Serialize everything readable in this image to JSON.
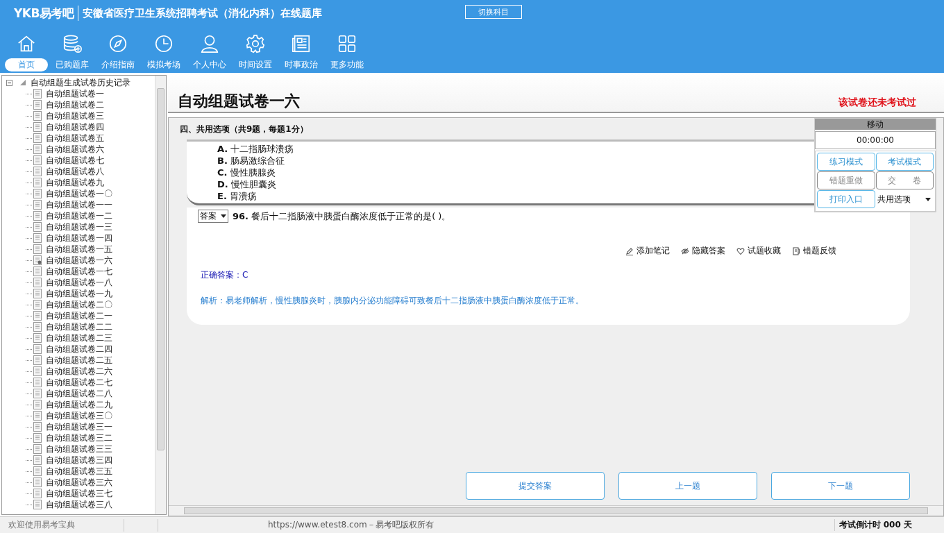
{
  "header": {
    "logo": "YKB易考吧",
    "title": "安徽省医疗卫生系统招聘考试（消化内科）在线题库",
    "switch_button": "切换科目"
  },
  "nav": [
    {
      "label": "首页",
      "selected": true
    },
    {
      "label": "已购题库",
      "selected": false
    },
    {
      "label": "介绍指南",
      "selected": false
    },
    {
      "label": "模拟考场",
      "selected": false
    },
    {
      "label": "个人中心",
      "selected": false
    },
    {
      "label": "时间设置",
      "selected": false
    },
    {
      "label": "时事政治",
      "selected": false
    },
    {
      "label": "更多功能",
      "selected": false
    }
  ],
  "tree": {
    "root": "自动组题生成试卷历史记录",
    "expanded": true,
    "children": [
      {
        "label": "自动组题试卷一",
        "current": false
      },
      {
        "label": "自动组题试卷二",
        "current": false
      },
      {
        "label": "自动组题试卷三",
        "current": false
      },
      {
        "label": "自动组题试卷四",
        "current": false
      },
      {
        "label": "自动组题试卷五",
        "current": false
      },
      {
        "label": "自动组题试卷六",
        "current": false
      },
      {
        "label": "自动组题试卷七",
        "current": false
      },
      {
        "label": "自动组题试卷八",
        "current": false
      },
      {
        "label": "自动组题试卷九",
        "current": false
      },
      {
        "label": "自动组题试卷一〇",
        "current": false
      },
      {
        "label": "自动组题试卷一一",
        "current": false
      },
      {
        "label": "自动组题试卷一二",
        "current": false
      },
      {
        "label": "自动组题试卷一三",
        "current": false
      },
      {
        "label": "自动组题试卷一四",
        "current": false
      },
      {
        "label": "自动组题试卷一五",
        "current": false
      },
      {
        "label": "自动组题试卷一六",
        "current": true
      },
      {
        "label": "自动组题试卷一七",
        "current": false
      },
      {
        "label": "自动组题试卷一八",
        "current": false
      },
      {
        "label": "自动组题试卷一九",
        "current": false
      },
      {
        "label": "自动组题试卷二〇",
        "current": false
      },
      {
        "label": "自动组题试卷二一",
        "current": false
      },
      {
        "label": "自动组题试卷二二",
        "current": false
      },
      {
        "label": "自动组题试卷二三",
        "current": false
      },
      {
        "label": "自动组题试卷二四",
        "current": false
      },
      {
        "label": "自动组题试卷二五",
        "current": false
      },
      {
        "label": "自动组题试卷二六",
        "current": false
      },
      {
        "label": "自动组题试卷二七",
        "current": false
      },
      {
        "label": "自动组题试卷二八",
        "current": false
      },
      {
        "label": "自动组题试卷二九",
        "current": false
      },
      {
        "label": "自动组题试卷三〇",
        "current": false
      },
      {
        "label": "自动组题试卷三一",
        "current": false
      },
      {
        "label": "自动组题试卷三二",
        "current": false
      },
      {
        "label": "自动组题试卷三三",
        "current": false
      },
      {
        "label": "自动组题试卷三四",
        "current": false
      },
      {
        "label": "自动组题试卷三五",
        "current": false
      },
      {
        "label": "自动组题试卷三六",
        "current": false
      },
      {
        "label": "自动组题试卷三七",
        "current": false
      },
      {
        "label": "自动组题试卷三八",
        "current": false
      }
    ]
  },
  "paper": {
    "title": "自动组题试卷一六",
    "status": "该试卷还未考试过"
  },
  "section": "四、共用选项（共9题，每题1分）",
  "options": [
    {
      "letter": "A.",
      "text": "十二指肠球溃疡"
    },
    {
      "letter": "B.",
      "text": "肠易激综合征"
    },
    {
      "letter": "C.",
      "text": "慢性胰腺炎"
    },
    {
      "letter": "D.",
      "text": "慢性胆囊炎"
    },
    {
      "letter": "E.",
      "text": "胃溃疡"
    }
  ],
  "question": {
    "answer_select": "答案",
    "number": "96.",
    "text": "餐后十二指肠液中胰蛋白酶浓度低于正常的是( )。"
  },
  "tools": [
    "添加笔记",
    "隐藏答案",
    "试题收藏",
    "错题反馈"
  ],
  "answer": {
    "label": "正确答案：",
    "value": "C"
  },
  "analysis": "解析：易老师解析，慢性胰腺炎时，胰腺内分泌功能障碍可致餐后十二指肠液中胰蛋白酶浓度低于正常。",
  "nav_buttons": [
    "提交答案",
    "上一题",
    "下一题"
  ],
  "panel": {
    "handle": "移动",
    "timer": "00:00:00",
    "buttons": [
      {
        "label": "练习模式",
        "kind": "blue"
      },
      {
        "label": "考试模式",
        "kind": "blue"
      },
      {
        "label": "错题重做",
        "kind": "grey"
      },
      {
        "label": "交　　卷",
        "kind": "grey"
      },
      {
        "label": "打印入口",
        "kind": "blue"
      }
    ],
    "select": "共用选项"
  },
  "status_bar": {
    "welcome": "欢迎使用易考宝典",
    "url": "https://www.etest8.com－易考吧版权所有",
    "countdown_label": "考试倒计时",
    "countdown": "000 天"
  }
}
